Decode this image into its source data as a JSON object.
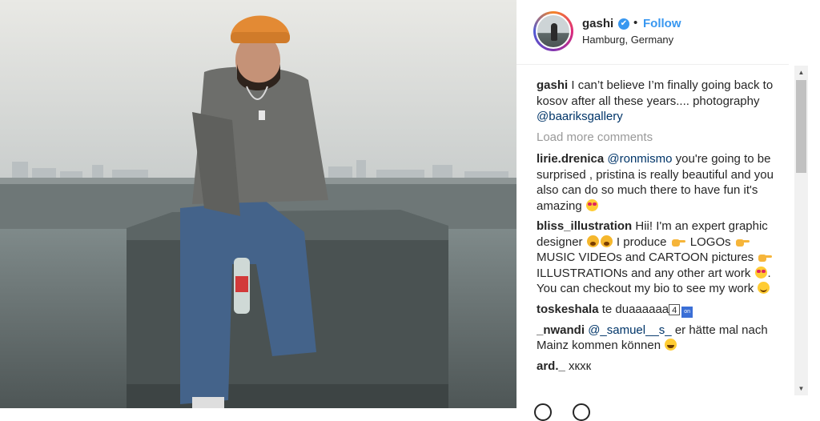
{
  "post": {
    "username": "gashi",
    "verified_mark": "✔",
    "separator": "•",
    "follow_label": "Follow",
    "location": "Hamburg, Germany",
    "caption_user": "gashi",
    "caption_text": "I can’t believe I’m finally going back to kosov after all these years.... photography",
    "caption_mention": "@baariksgallery",
    "load_more_label": "Load more comments"
  },
  "comments": [
    {
      "user": "lirie.drenica",
      "mention": "@ronmismo",
      "text": "you're going to be surprised , pristina is really beautiful and you also can do so much there to have fun it's amazing",
      "emoji": [
        "heart-eyes-emoji"
      ]
    },
    {
      "user": "bliss_illustration",
      "text_1": "Hii! I'm an expert graphic designer",
      "text_2": "I produce",
      "text_3": "LOGOs",
      "text_4": "MUSIC VIDEOs and CARTOON pictures",
      "text_5": "ILLUSTRATIONs and any other art work",
      "text_6": ". You can checkout my bio to see my work",
      "emoji": [
        "fearful-emoji",
        "pointing-hand-emoji",
        "heart-eyes-emoji",
        "smile-emoji"
      ]
    },
    {
      "user": "toskeshala",
      "text": "te duaaaaaa",
      "keycap": "4",
      "arrow": "on"
    },
    {
      "user": "_nwandi",
      "mention": "@_samuel__s_",
      "text": "er hätte mal nach Mainz kommen können",
      "emoji": [
        "grinning-sweat-emoji"
      ]
    },
    {
      "user": "ard._",
      "text": "хкхк"
    }
  ],
  "scrollbar": {
    "up": "▲",
    "down": "▼"
  },
  "colors": {
    "link": "#3897f0",
    "mention": "#003569",
    "muted": "#999999",
    "text": "#262626"
  }
}
